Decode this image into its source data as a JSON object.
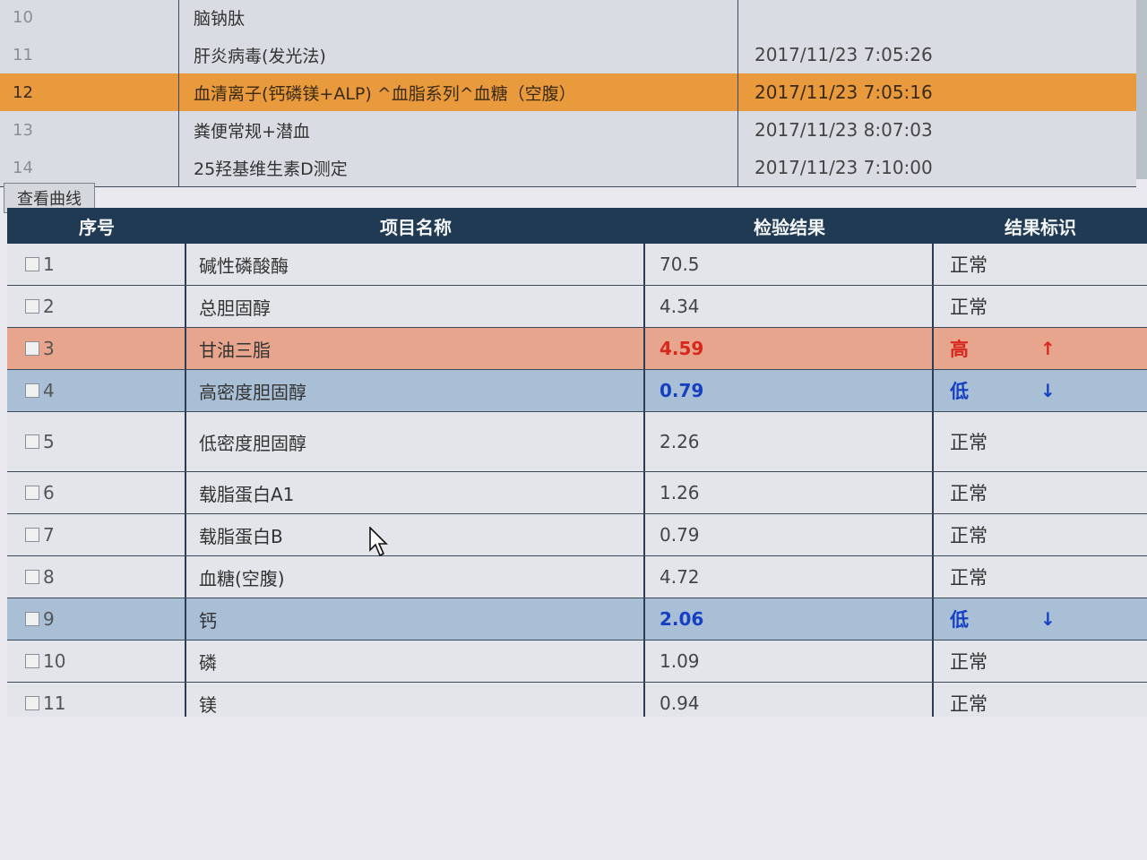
{
  "order_list": {
    "rows": [
      {
        "no": "10",
        "name": "脑钠肽",
        "time": ""
      },
      {
        "no": "11",
        "name": "肝炎病毒(发光法)",
        "time": "2017/11/23 7:05:26"
      },
      {
        "no": "12",
        "name": "血清离子(钙磷镁+ALP) ^血脂系列^血糖（空腹）",
        "time": "2017/11/23 7:05:16",
        "selected": true
      },
      {
        "no": "13",
        "name": "粪便常规+潜血",
        "time": "2017/11/23 8:07:03"
      },
      {
        "no": "14",
        "name": "25羟基维生素D测定",
        "time": "2017/11/23 7:10:00"
      }
    ]
  },
  "toolbar": {
    "curve_label": "查看曲线"
  },
  "results_table": {
    "headers": {
      "seq": "序号",
      "name": "项目名称",
      "value": "检验结果",
      "flag": "结果标识"
    },
    "rows": [
      {
        "seq": "1",
        "name": "碱性磷酸酶",
        "value": "70.5",
        "flag": "正常",
        "arrow": ""
      },
      {
        "seq": "2",
        "name": "总胆固醇",
        "value": "4.34",
        "flag": "正常",
        "arrow": ""
      },
      {
        "seq": "3",
        "name": "甘油三脂",
        "value": "4.59",
        "flag": "高",
        "arrow": "↑"
      },
      {
        "seq": "4",
        "name": "高密度胆固醇",
        "value": "0.79",
        "flag": "低",
        "arrow": "↓"
      },
      {
        "seq": "5",
        "name": "低密度胆固醇",
        "value": "2.26",
        "flag": "正常",
        "arrow": ""
      },
      {
        "seq": "6",
        "name": "载脂蛋白A1",
        "value": "1.26",
        "flag": "正常",
        "arrow": ""
      },
      {
        "seq": "7",
        "name": "载脂蛋白B",
        "value": "0.79",
        "flag": "正常",
        "arrow": ""
      },
      {
        "seq": "8",
        "name": "血糖(空腹)",
        "value": "4.72",
        "flag": "正常",
        "arrow": ""
      },
      {
        "seq": "9",
        "name": "钙",
        "value": "2.06",
        "flag": "低",
        "arrow": "↓"
      },
      {
        "seq": "10",
        "name": "磷",
        "value": "1.09",
        "flag": "正常",
        "arrow": ""
      },
      {
        "seq": "11",
        "name": "镁",
        "value": "0.94",
        "flag": "正常",
        "arrow": ""
      }
    ]
  },
  "colors": {
    "header_bg": "#1f3a52",
    "selected_row": "#e89a3c",
    "high": "#d8281e",
    "low": "#1640c2"
  }
}
